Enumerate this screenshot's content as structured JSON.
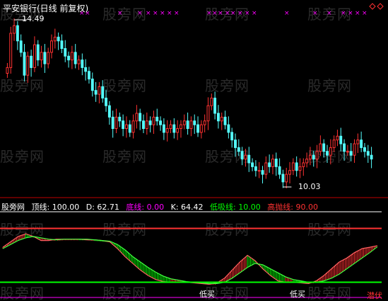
{
  "header": {
    "title": "平安银行(日线 前复权)"
  },
  "watermark": "股旁网",
  "main_chart": {
    "high_label": "14.49",
    "low_label": "10.03",
    "colors": {
      "up": "#ff3232",
      "down": "#54ffff",
      "marker": "#ff00ff",
      "text": "#ffffff"
    }
  },
  "indicator": {
    "name": "股旁网",
    "items": [
      {
        "label": "顶线:",
        "value": "100.00",
        "color": "#ffffff"
      },
      {
        "label": "D:",
        "value": "62.71",
        "color": "#ffffff"
      },
      {
        "label": "底线:",
        "value": "0.00",
        "color": "#ff00ff"
      },
      {
        "label": "K:",
        "value": "64.42",
        "color": "#ffffff"
      },
      {
        "label": "低吸线:",
        "value": "10.00",
        "color": "#00ff00"
      },
      {
        "label": "高抛线:",
        "value": "90.00",
        "color": "#ff3232"
      }
    ],
    "buy_label": "低买",
    "lurk_label": "潜伏",
    "colors": {
      "top_line": "#ffffff",
      "high_line": "#ff3232",
      "low_line": "#00ff00",
      "bottom_line": "#ff00ff",
      "k_up": "#ff3232",
      "k_down": "#00ff00"
    }
  },
  "chart_data": [
    {
      "type": "candlestick",
      "title": "平安银行(日线 前复权)",
      "ylim": [
        10.03,
        14.49
      ],
      "annotations": [
        {
          "text": "14.49",
          "kind": "max"
        },
        {
          "text": "10.03",
          "kind": "min"
        }
      ],
      "series": [
        {
          "name": "close",
          "values": [
            13.2,
            14.1,
            14.3,
            13.9,
            13.6,
            13.0,
            13.5,
            13.2,
            13.8,
            13.4,
            13.6,
            13.3,
            13.6,
            13.9,
            14.0,
            13.9,
            13.7,
            13.5,
            13.4,
            13.6,
            13.3,
            13.4,
            13.2,
            13.1,
            12.9,
            12.6,
            12.5,
            12.7,
            12.4,
            12.2,
            11.9,
            11.6,
            11.9,
            11.8,
            11.6,
            11.7,
            11.5,
            11.8,
            12.0,
            11.8,
            11.6,
            11.8,
            11.7,
            11.9,
            11.8,
            11.7,
            11.5,
            11.6,
            11.7,
            11.5,
            11.6,
            11.7,
            11.8,
            11.6,
            11.8,
            11.7,
            11.5,
            11.7,
            11.8,
            12.2,
            12.4,
            12.0,
            11.8,
            11.9,
            11.7,
            11.5,
            11.3,
            11.1,
            11.0,
            10.8,
            10.9,
            10.7,
            10.6,
            10.5,
            10.5,
            10.4,
            10.7,
            10.6,
            10.8,
            10.6,
            10.4,
            10.2,
            10.4,
            10.5,
            10.7,
            10.5,
            10.6,
            10.7,
            10.8,
            10.9,
            10.8,
            11.0,
            11.2,
            11.0,
            10.9,
            11.1,
            11.3,
            11.4,
            11.2,
            11.0,
            11.0,
            10.9,
            11.2,
            11.3,
            11.1,
            11.0,
            10.9,
            10.8
          ]
        }
      ]
    },
    {
      "type": "line",
      "title": "股旁网",
      "ylim": [
        0,
        100
      ],
      "lines": [
        {
          "name": "顶线",
          "value": 100.0
        },
        {
          "name": "高抛线",
          "value": 90.0
        },
        {
          "name": "低吸线",
          "value": 10.0
        },
        {
          "name": "底线",
          "value": 0.0
        }
      ],
      "series": [
        {
          "name": "K",
          "last": 64.42,
          "values": [
            62,
            70,
            78,
            82,
            78,
            72,
            72,
            74,
            74,
            74,
            74,
            73,
            73,
            72,
            70,
            60,
            48,
            38,
            28,
            20,
            14,
            11,
            10,
            10,
            10,
            9,
            8,
            7,
            9,
            16,
            28,
            40,
            50,
            42,
            30,
            20,
            12,
            10,
            10,
            9,
            8,
            12,
            20,
            30,
            40,
            46,
            54,
            60,
            62,
            64.42
          ]
        },
        {
          "name": "D",
          "last": 62.71,
          "values": [
            60,
            66,
            72,
            76,
            78,
            76,
            74,
            73,
            74,
            74,
            74,
            74,
            73,
            72,
            71,
            66,
            58,
            48,
            40,
            32,
            25,
            19,
            15,
            13,
            11,
            10,
            9,
            8,
            8,
            10,
            16,
            24,
            32,
            38,
            36,
            30,
            24,
            18,
            14,
            12,
            10,
            10,
            12,
            16,
            22,
            30,
            38,
            46,
            54,
            62.71
          ]
        }
      ]
    }
  ]
}
